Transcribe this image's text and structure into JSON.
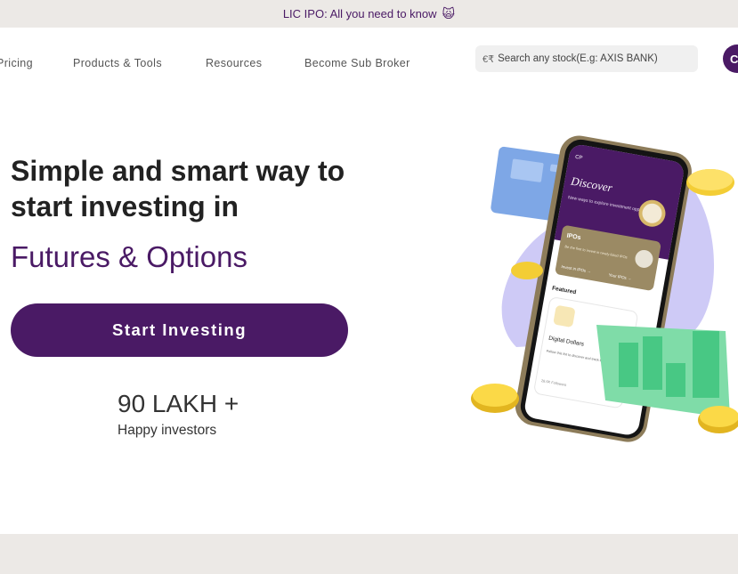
{
  "announcement": {
    "text": "LIC IPO: All you need to know",
    "emoji": "🙀"
  },
  "nav": {
    "items": [
      "Pricing",
      "Products & Tools",
      "Resources",
      "Become Sub Broker"
    ],
    "search_placeholder": "Search any stock(E.g: AXIS BANK)",
    "search_prefix": "€₹",
    "avatar_letter": "C"
  },
  "hero": {
    "title": "Simple and smart way to start investing in",
    "subtitle": "Futures & Options",
    "cta_label": "Start Investing",
    "stat_value": "90 LAKH +",
    "stat_label": "Happy investors"
  },
  "phone": {
    "logo": "CP",
    "discover_title": "Discover",
    "discover_sub": "New ways to explore investment opportunities",
    "ipo_title": "IPOs",
    "ipo_desc": "Be the first to invest in newly listed IPOs",
    "ipo_link1": "Invest in IPOs →",
    "ipo_link2": "Your IPOs →",
    "featured": "Featured",
    "card_title": "Digital Dollars",
    "card_desc": "Follow this list to discover and track the technology industry.",
    "card_followers": "28.6K Followers"
  },
  "colors": {
    "brand": "#4a1a65",
    "band": "#ece9e6"
  }
}
